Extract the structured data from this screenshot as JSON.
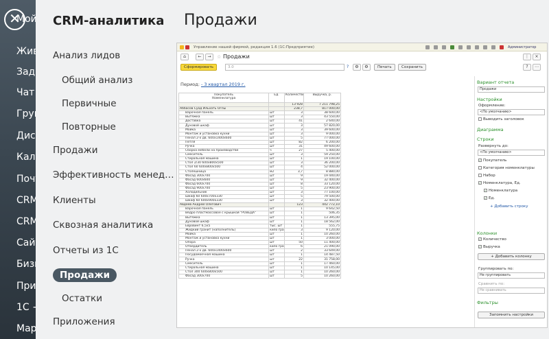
{
  "bg_items": [
    "Мой",
    "Жив",
    "Зада",
    "Чат",
    "Груп",
    "Диск",
    "Кале",
    "Почт",
    "CRM",
    "CRM",
    "Сайт",
    "Бизн",
    "При",
    "1С +",
    "Мар"
  ],
  "crm_title": "CRM-аналитика",
  "page_title": "Продажи",
  "menu": [
    {
      "label": "Анализ лидов"
    },
    {
      "label": "Общий анализ"
    },
    {
      "label": "Первичные"
    },
    {
      "label": "Повторные"
    },
    {
      "label": "Продажи"
    },
    {
      "label": "Эффективность менеджер..."
    },
    {
      "label": "Клиенты"
    },
    {
      "label": "Сквозная аналитика"
    },
    {
      "label": "Отчеты из 1С"
    },
    {
      "label": "Продажи"
    },
    {
      "label": "Остатки"
    },
    {
      "label": "Приложения"
    }
  ],
  "onec": {
    "window_title": "Управление нашей фирмой, редакция 1.6   (1С:Предприятие)",
    "user": "Администратор",
    "doc_title": "Продажи",
    "form_button": "Сформировать",
    "variant_value": "3.0",
    "print_button": "Печать",
    "save_button": "Сохранить",
    "help": "?",
    "period_label": "Период:",
    "period_value": "- 3 квартал 2019 г.",
    "col_buyer": "Покупатель",
    "col_item": "Номенклатура",
    "col_unit": "Ед.",
    "col_qty": "Количество",
    "col_rev": "Выручка, р.",
    "rows": [
      [
        "",
        "",
        "13 928",
        "7 211 798,25"
      ],
      [
        "Аббасов Суад Ильхать Оглы",
        "",
        "238,7",
        "817 000,00"
      ],
      [
        "Варочная панель",
        "шт",
        "3",
        "38 600,00"
      ],
      [
        "Вытяжка",
        "шт",
        "3",
        "43 550,00"
      ],
      [
        "Доставка",
        "шт",
        "41",
        "2 640,00"
      ],
      [
        "Духовой шкаф",
        "шт",
        "3",
        "57 820,00"
      ],
      [
        "Мойка",
        "шт",
        "3",
        "39 600,00"
      ],
      [
        "Монтаж и установка кухни",
        "шт",
        "3",
        "9 000,00"
      ],
      [
        "Пенал 2-х дв. 600x1400x600",
        "шт",
        "5",
        "77 000,00"
      ],
      [
        "Петля",
        "шт",
        "82",
        "6 200,00"
      ],
      [
        "Ручка",
        "шт",
        "31",
        "49 600,00"
      ],
      [
        "Сборка мебели на производстве",
        "ч",
        "27",
        "5 400,00"
      ],
      [
        "Смеситель",
        "шт",
        "3",
        "59 250,00"
      ],
      [
        "Стиральная машина",
        "шт",
        "1",
        "19 100,00"
      ],
      [
        "Стол 2/30 600x800x500",
        "шт",
        "3",
        "36 200,00"
      ],
      [
        "Стол 60 600x800x500",
        "шт",
        "4",
        "52 000,00"
      ],
      [
        "Столешница",
        "м2",
        "3,7",
        "8 880,00"
      ],
      [
        "Фасад 300x700",
        "шт",
        "9",
        "19 440,00"
      ],
      [
        "Фасад 600x600",
        "шт",
        "9",
        "32 400,00"
      ],
      [
        "Фасад 600x700",
        "шт",
        "8",
        "33 120,00"
      ],
      [
        "Фасад 900x700",
        "шт",
        "5",
        "23 900,00"
      ],
      [
        "Холодильник",
        "шт",
        "3",
        "77 100,00"
      ],
      [
        "Шкаф 60 600x700x330",
        "шт",
        "5",
        "79 500,00"
      ],
      [
        "Шкаф 60 600x900x330",
        "шт",
        "3",
        "32 400,00"
      ],
      [
        "Авдеев Андрей Олегович",
        "",
        "123",
        "442 772,10"
      ],
      [
        "Варочная панель",
        "шт",
        "1",
        "9 642,50"
      ],
      [
        "Ведро пластмассовое с крышкой \"РОВЕДА\"",
        "шт",
        "1",
        "506,35"
      ],
      [
        "Вытяжка",
        "шт",
        "1",
        "13 395,00"
      ],
      [
        "Духовой шкаф",
        "шт",
        "1",
        "18 562,00"
      ],
      [
        "Евровинт 6,5х5",
        "тыс. шт",
        "1",
        "555,75"
      ],
      [
        "Жидкий гранит (наполнитель)",
        "кило грам м",
        "3",
        "9 120,00"
      ],
      [
        "Мойка",
        "шт",
        "1",
        "10 260,00"
      ],
      [
        "Монтаж и установка кухни",
        "шт",
        "1",
        "3 000,00"
      ],
      [
        "Опора",
        "шт",
        "50",
        "11 400,00"
      ],
      [
        "Отвердитель",
        "кило грам м",
        "6",
        "21 090,00"
      ],
      [
        "Пенал 2-х дв. 600x1400x600",
        "шт",
        "2",
        "33 649,00"
      ],
      [
        "Посудомоечная машина",
        "шт",
        "1",
        "14 487,50"
      ],
      [
        "Ручка",
        "шт",
        "22",
        "31 758,00"
      ],
      [
        "Смеситель",
        "шт",
        "1",
        "17 460,00"
      ],
      [
        "Стиральная машина",
        "шт",
        "1",
        "10 145,00"
      ],
      [
        "Стол 300 600x800x500",
        "шт",
        "1",
        "10 260,00"
      ],
      [
        "Фасад 300x700",
        "шт",
        "5",
        "10 260,00"
      ]
    ],
    "side": {
      "variant_h": "Вариант отчета",
      "variant_sel": "Продажи",
      "settings_h": "Настройки",
      "design_l": "Оформление:",
      "design_sel": "<По умолчанию>",
      "show_title": "Выводить заголовок",
      "diagram_h": "Диаграмма",
      "rows_h": "Строки",
      "expand_l": "Развернуть до:",
      "expand_sel": "<По умолчанию>",
      "chk_buyer": "Покупатель",
      "chk_cat": "Категория номенклатуры",
      "chk_set": "Набор",
      "chk_nom_unit": "Номенклатура, Ед.",
      "chk_nom": "Номенклатура",
      "chk_unit": "Ед.",
      "add_row": "+ Добавить строку",
      "cols_h": "Колонки",
      "chk_qty": "Количество",
      "chk_rev": "Выручка",
      "add_col": "+ Добавить колонку",
      "group_l": "Группировать по:",
      "group_sel": "Не группировать",
      "compare_l": "Сравнить по:",
      "compare_sel": "Не сравнивать",
      "filters_h": "Фильтры",
      "remember": "Запомнить настройки"
    }
  }
}
